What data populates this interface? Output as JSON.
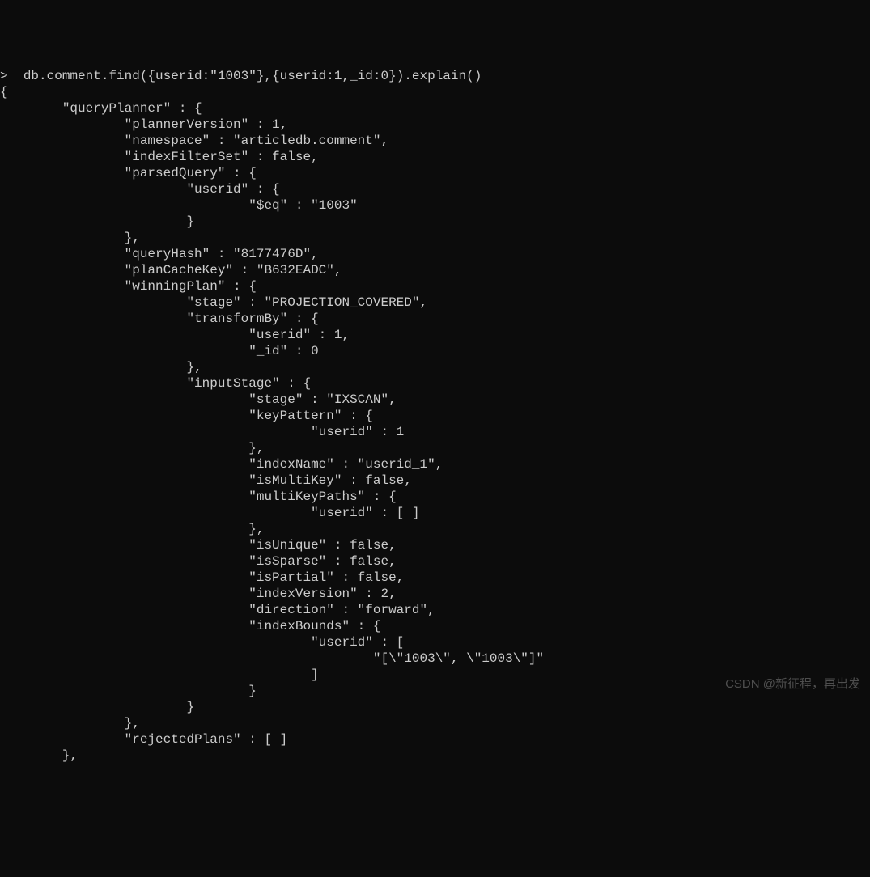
{
  "prompt_char": ">",
  "command": "db.comment.find({userid:\"1003\"},{userid:1,_id:0}).explain()",
  "lines": [
    "{",
    "        \"queryPlanner\" : {",
    "                \"plannerVersion\" : 1,",
    "                \"namespace\" : \"articledb.comment\",",
    "                \"indexFilterSet\" : false,",
    "                \"parsedQuery\" : {",
    "                        \"userid\" : {",
    "                                \"$eq\" : \"1003\"",
    "                        }",
    "                },",
    "                \"queryHash\" : \"8177476D\",",
    "                \"planCacheKey\" : \"B632EADC\",",
    "                \"winningPlan\" : {",
    "                        \"stage\" : \"PROJECTION_COVERED\",",
    "                        \"transformBy\" : {",
    "                                \"userid\" : 1,",
    "                                \"_id\" : 0",
    "                        },",
    "                        \"inputStage\" : {",
    "                                \"stage\" : \"IXSCAN\",",
    "                                \"keyPattern\" : {",
    "                                        \"userid\" : 1",
    "                                },",
    "                                \"indexName\" : \"userid_1\",",
    "                                \"isMultiKey\" : false,",
    "                                \"multiKeyPaths\" : {",
    "                                        \"userid\" : [ ]",
    "                                },",
    "                                \"isUnique\" : false,",
    "                                \"isSparse\" : false,",
    "                                \"isPartial\" : false,",
    "                                \"indexVersion\" : 2,",
    "                                \"direction\" : \"forward\",",
    "                                \"indexBounds\" : {",
    "                                        \"userid\" : [",
    "                                                \"[\\\"1003\\\", \\\"1003\\\"]\"",
    "                                        ]",
    "                                }",
    "                        }",
    "                },",
    "                \"rejectedPlans\" : [ ]",
    "        },"
  ],
  "watermark": "CSDN @新征程，再出发"
}
